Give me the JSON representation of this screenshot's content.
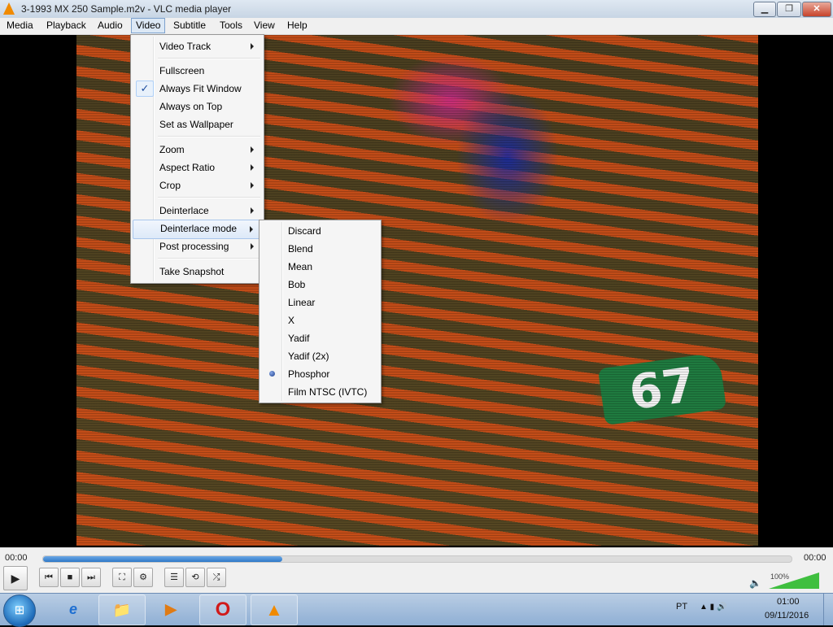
{
  "window": {
    "title": "3-1993 MX 250 Sample.m2v - VLC media player"
  },
  "titlebar_buttons": {
    "minimize": "▁",
    "maximize": "❐",
    "close": "✕"
  },
  "menubar": [
    "Media",
    "Playback",
    "Audio",
    "Video",
    "Subtitle",
    "Tools",
    "View",
    "Help"
  ],
  "video_menu": {
    "video_track": "Video Track",
    "fullscreen": "Fullscreen",
    "always_fit_window": "Always Fit Window",
    "always_on_top": "Always on Top",
    "set_as_wallpaper": "Set as Wallpaper",
    "zoom": "Zoom",
    "aspect_ratio": "Aspect Ratio",
    "crop": "Crop",
    "deinterlace": "Deinterlace",
    "deinterlace_mode": "Deinterlace mode",
    "post_processing": "Post processing",
    "take_snapshot": "Take Snapshot",
    "check_mark": "✓"
  },
  "deinterlace_submenu": [
    "Discard",
    "Blend",
    "Mean",
    "Bob",
    "Linear",
    "X",
    "Yadif",
    "Yadif (2x)",
    "Phosphor",
    "Film NTSC (IVTC)"
  ],
  "selected_deinterlace_mode": "Phosphor",
  "video": {
    "plate_number": "67"
  },
  "player": {
    "elapsed": "00:00",
    "total": "00:00",
    "progress": 0.32,
    "volume": "100%",
    "volume_level": 1.0,
    "buttons": {
      "play": "▶",
      "prev": "⏮",
      "stop": "■",
      "next": "⏭",
      "fullscreen": "⛶",
      "extended": "⚙",
      "playlist": "☰",
      "loop": "⟲",
      "random": "⤮",
      "mute": "🔈"
    }
  },
  "taskbar": {
    "start": "⊞",
    "apps": [
      "e",
      "📁",
      "▶",
      "O",
      "▲"
    ],
    "language": "PT",
    "tray_icons": "▲ ▮ 🔊",
    "time": "01:00",
    "date": "09/11/2016"
  },
  "colors": {
    "accent": "#2e78c7",
    "vlc_orange": "#f08a00",
    "taskbar": "#9fb9d9"
  }
}
